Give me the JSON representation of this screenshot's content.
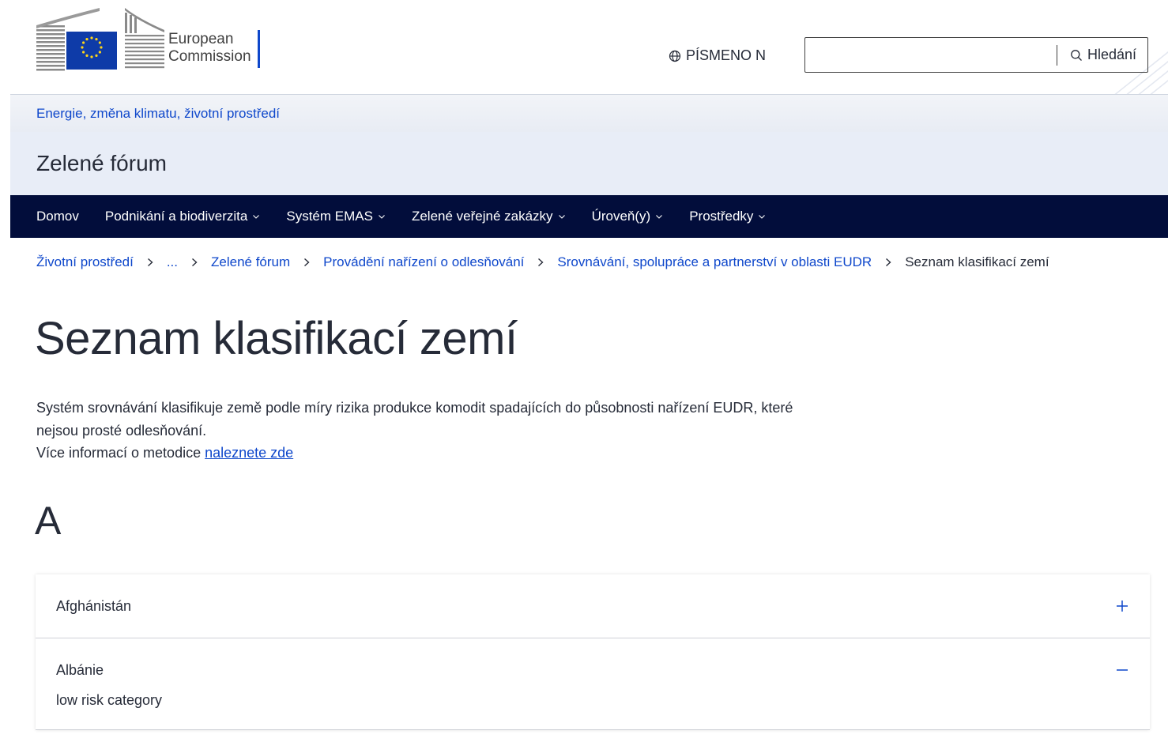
{
  "header": {
    "logo_line1": "European",
    "logo_line2": "Commission",
    "language_label": "PÍSMENO N",
    "search_value": "",
    "search_button_label": "Hledání"
  },
  "site": {
    "parent_link": "Energie, změna klimatu, životní prostředí",
    "name": "Zelené fórum"
  },
  "nav": {
    "items": [
      {
        "label": "Domov"
      },
      {
        "label": "Podnikání a biodiverzita"
      },
      {
        "label": "Systém EMAS"
      },
      {
        "label": "Zelené veřejné zakázky"
      },
      {
        "label": "Úroveň(y)"
      },
      {
        "label": "Prostředky"
      }
    ]
  },
  "breadcrumb": {
    "items": [
      {
        "label": "Životní prostředí"
      },
      {
        "label": "..."
      },
      {
        "label": "Zelené fórum"
      },
      {
        "label": "Provádění nařízení o odlesňování"
      },
      {
        "label": "Srovnávání, spolupráce a partnerství v oblasti EUDR"
      }
    ],
    "current": "Seznam klasifikací zemí"
  },
  "main": {
    "title": "Seznam klasifikací zemí",
    "intro_text": "Systém srovnávání klasifikuje země podle míry rizika produkce komodit spadajících do působnosti nařízení EUDR, které nejsou prosté odlesňování.",
    "more_info_prefix": "Více informací o metodice ",
    "more_info_link": "naleznete zde",
    "letter": "A",
    "accordion": [
      {
        "title": "Afghánistán",
        "state": "collapsed",
        "icon": "plus-icon"
      },
      {
        "title": "Albánie",
        "state": "expanded",
        "icon": "minus-icon",
        "content": "low risk category"
      }
    ]
  },
  "colors": {
    "primary_link": "#0e47cb",
    "nav_background": "#020d3b",
    "site_band": "#e8edf7",
    "text": "#262b38"
  }
}
